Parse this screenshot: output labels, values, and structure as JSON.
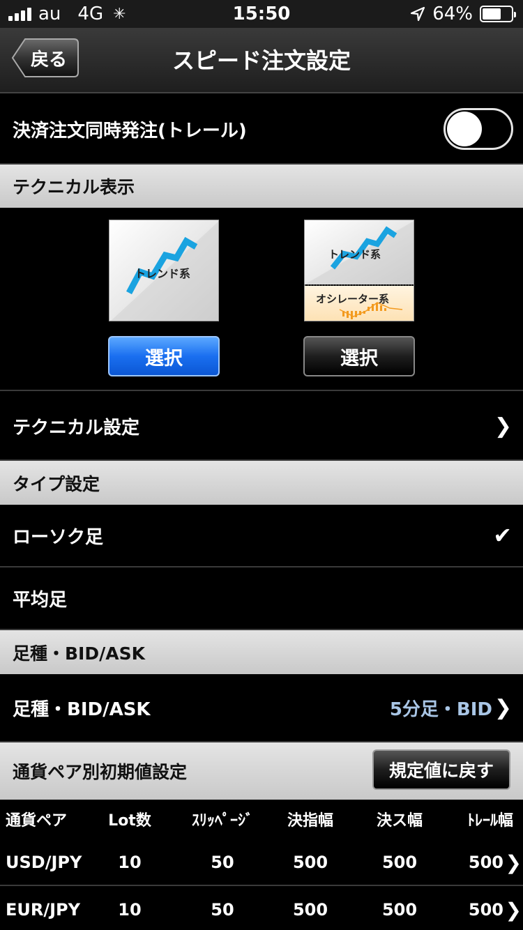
{
  "status_bar": {
    "carrier": "au",
    "network": "4G",
    "time": "15:50",
    "battery": "64%",
    "battery_level": 0.64
  },
  "nav": {
    "back_label": "戻る",
    "title": "スピード注文設定"
  },
  "trail_order": {
    "label": "決済注文同時発注(トレール)",
    "enabled": false
  },
  "technical_display": {
    "header": "テクニカル表示",
    "options": [
      {
        "image_label": "トレンド系",
        "button": "選択",
        "selected": true
      },
      {
        "image_label_top": "トレンド系",
        "image_label_bottom": "オシレーター系",
        "button": "選択",
        "selected": false
      }
    ]
  },
  "technical_settings": {
    "label": "テクニカル設定"
  },
  "type_settings": {
    "header": "タイプ設定",
    "items": [
      {
        "label": "ローソク足",
        "checked": true
      },
      {
        "label": "平均足",
        "checked": false
      }
    ]
  },
  "foot_type": {
    "header": "足種・BID/ASK",
    "label": "足種・BID/ASK",
    "value": "5分足・BID"
  },
  "pair_defaults": {
    "header": "通貨ペア別初期値設定",
    "reset_button": "規定値に戻す",
    "columns": [
      "通貨ペア",
      "Lot数",
      "ｽﾘｯﾍﾟｰｼﾞ",
      "決指幅",
      "決ス幅",
      "ﾄﾚｰﾙ幅"
    ],
    "rows": [
      [
        "USD/JPY",
        "10",
        "50",
        "500",
        "500",
        "500"
      ],
      [
        "EUR/JPY",
        "10",
        "50",
        "500",
        "500",
        "500"
      ]
    ]
  },
  "colors": {
    "selected_button": "#1a6ff0",
    "value_text": "#a9c6e6",
    "trend_line": "#1aa3e0",
    "oscillator": "#f39a1e"
  }
}
